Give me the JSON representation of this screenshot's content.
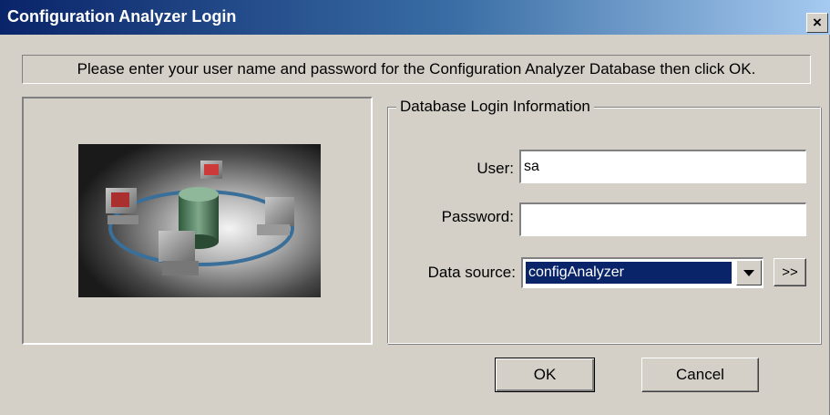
{
  "window": {
    "title": "Configuration Analyzer Login",
    "close_label": "×"
  },
  "instruction": "Please enter your user name and password for the Configuration Analyzer Database then click OK.",
  "group": {
    "legend": "Database Login Information"
  },
  "fields": {
    "user_label": "User:",
    "user_value": "sa",
    "password_label": "Password:",
    "password_value": "",
    "datasource_label": "Data source:",
    "datasource_value": "configAnalyzer"
  },
  "buttons": {
    "more_label": ">>",
    "ok_label": "OK",
    "cancel_label": "Cancel"
  },
  "colors": {
    "title_bar_start": "#0a246a",
    "title_bar_end": "#a6caf0",
    "dialog_bg": "#d4d0c8",
    "selection": "#0a246a"
  },
  "icons": {
    "close": "close-icon",
    "dropdown": "chevron-down-icon",
    "network": "network-illustration"
  }
}
